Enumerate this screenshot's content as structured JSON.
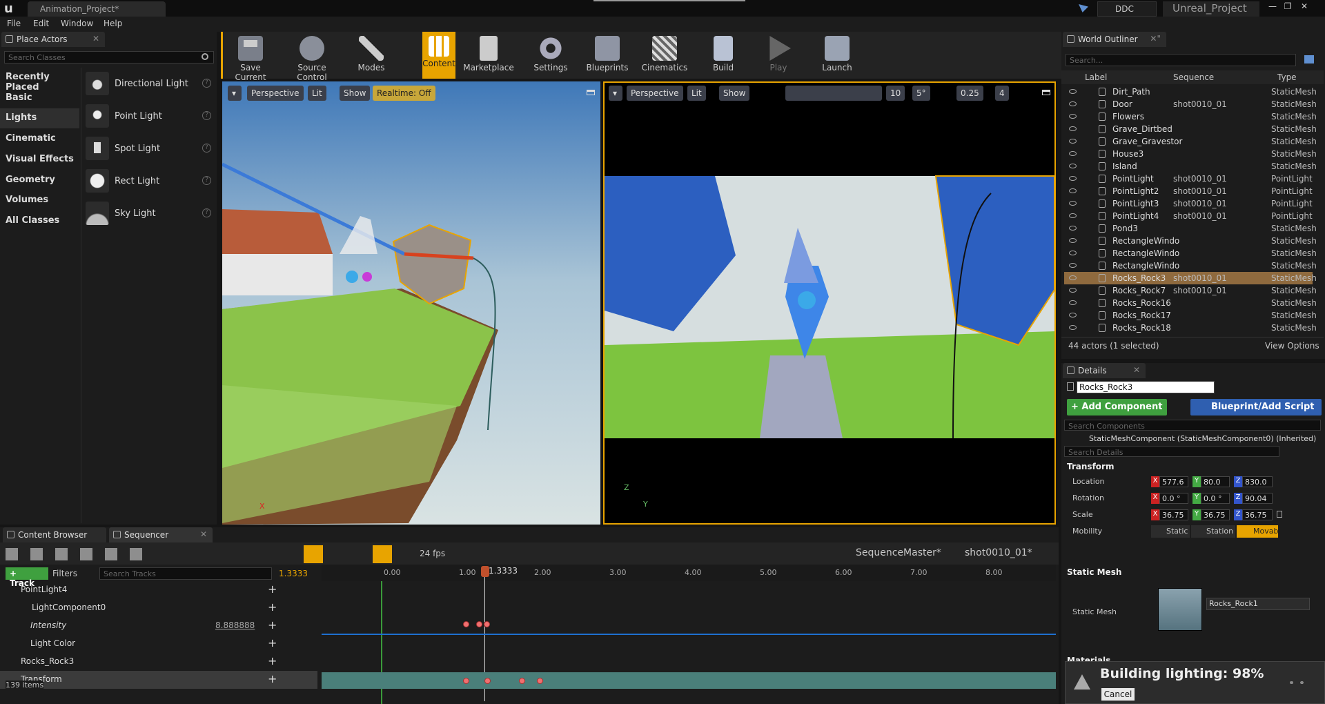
{
  "titlebar": {
    "doc_tab": "Animation_Project*",
    "ddc": "DDC",
    "project": "Unreal_Project",
    "min": "—",
    "max": "❐",
    "close": "✕"
  },
  "menu": [
    "File",
    "Edit",
    "Window",
    "Help"
  ],
  "place_actors": {
    "tab": "Place Actors",
    "search_placeholder": "Search Classes",
    "categories": [
      "Recently Placed",
      "Basic",
      "Lights",
      "Cinematic",
      "Visual Effects",
      "Geometry",
      "Volumes",
      "All Classes"
    ],
    "items": [
      "Directional Light",
      "Point Light",
      "Spot Light",
      "Rect Light",
      "Sky Light"
    ],
    "help": "?"
  },
  "toolbar": {
    "buttons": [
      "Save Current",
      "Source Control",
      "Modes",
      "Content",
      "Marketplace",
      "Settings",
      "Blueprints",
      "Cinematics",
      "Build",
      "Play",
      "Launch"
    ]
  },
  "viewport_left": {
    "menu": "▾",
    "perspective": "Perspective",
    "lit": "Lit",
    "show": "Show",
    "realtime": "Realtime: Off",
    "axis_x": "X"
  },
  "viewport_right": {
    "menu": "▾",
    "perspective": "Perspective",
    "lit": "Lit",
    "show": "Show",
    "grid": "10",
    "angle": "5°",
    "scale": "0.25",
    "cams": "4",
    "axis_y": "Y",
    "axis_z": "Z"
  },
  "outliner": {
    "tab": "World Outliner",
    "search_placeholder": "Search...",
    "col_label": "Label",
    "col_sequence": "Sequence",
    "col_type": "Type",
    "rows": [
      {
        "label": "Dirt_Path",
        "seq": "",
        "type": "StaticMesh"
      },
      {
        "label": "Door",
        "seq": "shot0010_01",
        "type": "StaticMesh"
      },
      {
        "label": "Flowers",
        "seq": "",
        "type": "StaticMesh"
      },
      {
        "label": "Grave_Dirtbed",
        "seq": "",
        "type": "StaticMesh"
      },
      {
        "label": "Grave_Gravestor",
        "seq": "",
        "type": "StaticMesh"
      },
      {
        "label": "House3",
        "seq": "",
        "type": "StaticMesh"
      },
      {
        "label": "Island",
        "seq": "",
        "type": "StaticMesh"
      },
      {
        "label": "PointLight",
        "seq": "shot0010_01",
        "type": "PointLight"
      },
      {
        "label": "PointLight2",
        "seq": "shot0010_01",
        "type": "PointLight"
      },
      {
        "label": "PointLight3",
        "seq": "shot0010_01",
        "type": "PointLight"
      },
      {
        "label": "PointLight4",
        "seq": "shot0010_01",
        "type": "PointLight"
      },
      {
        "label": "Pond3",
        "seq": "",
        "type": "StaticMesh"
      },
      {
        "label": "RectangleWindo",
        "seq": "",
        "type": "StaticMesh"
      },
      {
        "label": "RectangleWindo",
        "seq": "",
        "type": "StaticMesh"
      },
      {
        "label": "RectangleWindo",
        "seq": "",
        "type": "StaticMesh"
      },
      {
        "label": "Rocks_Rock3",
        "seq": "shot0010_01",
        "type": "StaticMesh"
      },
      {
        "label": "Rocks_Rock7",
        "seq": "shot0010_01",
        "type": "StaticMesh"
      },
      {
        "label": "Rocks_Rock16",
        "seq": "",
        "type": "StaticMesh"
      },
      {
        "label": "Rocks_Rock17",
        "seq": "",
        "type": "StaticMesh"
      },
      {
        "label": "Rocks_Rock18",
        "seq": "",
        "type": "StaticMesh"
      }
    ],
    "selected_index": 15,
    "count": "44 actors (1 selected)",
    "view_options": "View Options"
  },
  "details": {
    "tab": "Details",
    "name": "Rocks_Rock3",
    "add_component": "+ Add Component",
    "blueprint": "Blueprint/Add Script",
    "search_components": "Search Components",
    "component": "StaticMeshComponent (StaticMeshComponent0) (Inherited)",
    "search_details": "Search Details",
    "transform": "Transform",
    "location": "Location",
    "rotation": "Rotation",
    "scale": "Scale",
    "loc": [
      "577.6",
      "80.0",
      "830.0"
    ],
    "rot": [
      "0.0 °",
      "0.0 °",
      "90.04"
    ],
    "scl": [
      "36.75",
      "36.75",
      "36.75"
    ],
    "mobility": "Mobility",
    "mob_static": "Static",
    "mob_station": "Station",
    "mob_movab": "Movab",
    "static_mesh_section": "Static Mesh",
    "static_mesh_label": "Static Mesh",
    "mesh_value": "Rocks_Rock1",
    "materials": "Materials"
  },
  "bottom": {
    "tab_content": "Content Browser",
    "tab_sequencer": "Sequencer",
    "fps": "24 fps",
    "crumb_master": "SequenceMaster*",
    "crumb_shot": "shot0010_01*",
    "track_btn": "+ Track",
    "filters": "Filters",
    "search_tracks": "Search Tracks",
    "current_time": "1.3333",
    "playhead_label": "1.3333",
    "ticks": [
      "0.00",
      "1.00",
      "2.00",
      "3.00",
      "4.00",
      "5.00",
      "6.00",
      "7.00",
      "8.00"
    ],
    "tracks": [
      {
        "name": "PointLight4",
        "value": ""
      },
      {
        "name": "LightComponent0",
        "value": ""
      },
      {
        "name": "Intensity",
        "value": "8.888888"
      },
      {
        "name": "Light Color",
        "value": ""
      },
      {
        "name": "Rocks_Rock3",
        "value": ""
      },
      {
        "name": "Transform",
        "value": ""
      }
    ],
    "items_count": "139 items"
  },
  "toast": {
    "text": "Building lighting:  98%",
    "cancel": "Cancel"
  },
  "colors": {
    "accent": "#e8a400",
    "select": "#8f6a3e",
    "green_btn": "#3fa03f",
    "blue_btn": "#2f5fb0"
  }
}
